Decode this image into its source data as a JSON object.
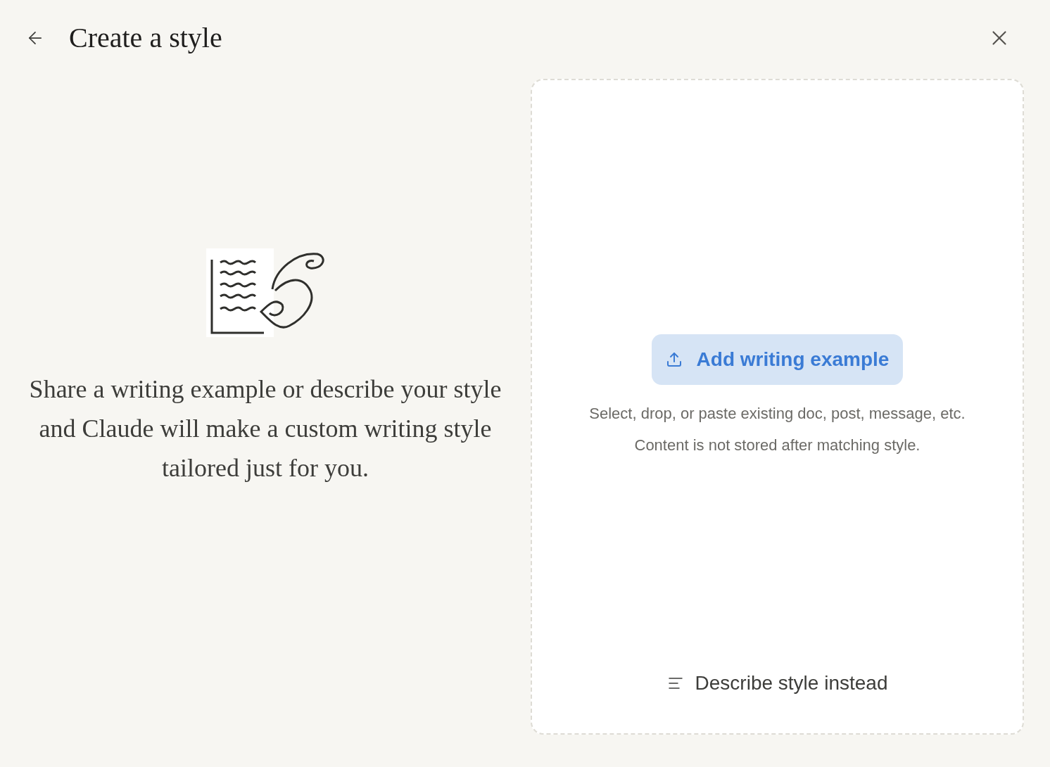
{
  "dialog": {
    "title": "Create a style"
  },
  "intro": {
    "text": "Share a writing example or describe your style and Claude will make a custom writing style tailored just for you."
  },
  "dropzone": {
    "button": "Add writing example",
    "hint_lines": [
      "Select, drop, or paste existing doc, post, message, etc.",
      "Content is not stored after matching style."
    ],
    "link": "Describe style instead"
  }
}
